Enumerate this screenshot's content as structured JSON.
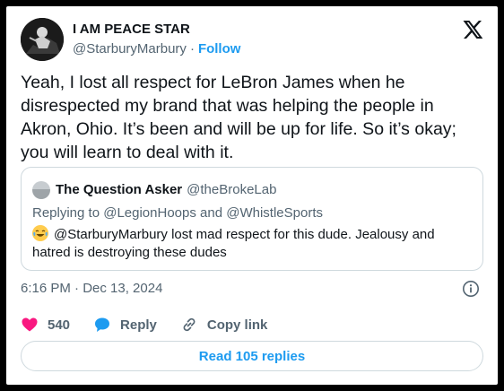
{
  "author": {
    "name": "I AM PEACE STAR",
    "handle": "@StarburyMarbury",
    "separator": "·",
    "follow_label": "Follow"
  },
  "logo_icon": "x-logo-icon",
  "tweet": {
    "text": "Yeah, I lost all respect for LeBron James when he disrespected my brand that was helping the people in Akron, Ohio. It’s been and will be up for life. So it’s okay; you will learn to deal with it."
  },
  "quote": {
    "name": "The Question Asker",
    "handle": "@theBrokeLab",
    "reply_prefix": "Replying to",
    "reply_mention_1": "@LegionHoops",
    "reply_and": "and",
    "reply_mention_2": "@WhistleSports",
    "emoji_icon": "tears-of-joy-emoji-icon",
    "text": "@StarburyMarbury lost mad respect for this dude. Jealousy and hatred is destroying these dudes"
  },
  "meta": {
    "timestamp": "6:16 PM · Dec 13, 2024",
    "info_icon": "info-icon"
  },
  "actions": {
    "like_count": "540",
    "reply_label": "Reply",
    "copy_label": "Copy link"
  },
  "read_replies_label": "Read 105 replies",
  "colors": {
    "accent": "#1d9bf0",
    "like": "#f91880",
    "muted": "#536471",
    "text": "#0f1419",
    "border": "#cfd9de"
  }
}
